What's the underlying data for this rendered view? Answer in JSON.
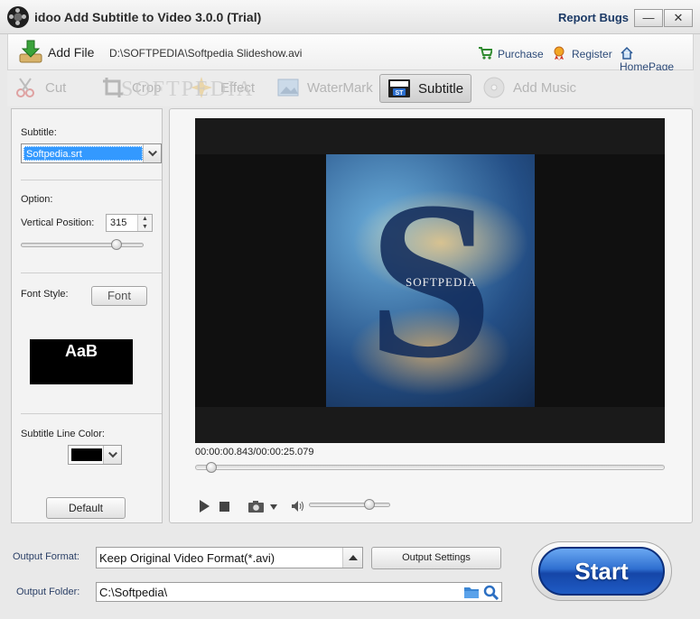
{
  "window": {
    "title": "idoo Add Subtitle to Video 3.0.0 (Trial)",
    "report_bugs": "Report Bugs",
    "minimize": "—",
    "close": "✕"
  },
  "file_bar": {
    "add_file": "Add File",
    "path": "D:\\SOFTPEDIA\\Softpedia Slideshow.avi",
    "purchase": "Purchase",
    "register": "Register",
    "homepage": "HomePage"
  },
  "tabs": [
    {
      "label": "Cut",
      "icon": "scissors-icon"
    },
    {
      "label": "Crop",
      "icon": "crop-icon"
    },
    {
      "label": "Effect",
      "icon": "sparkle-icon"
    },
    {
      "label": "WaterMark",
      "icon": "watermark-icon"
    },
    {
      "label": "Subtitle",
      "icon": "subtitle-icon",
      "active": true
    },
    {
      "label": "Add Music",
      "icon": "music-disc-icon"
    }
  ],
  "watermark_overlay": "SOFTPEDIA",
  "left_panel": {
    "subtitle_label": "Subtitle:",
    "subtitle_value": "Softpedia.srt",
    "option_label": "Option:",
    "vertical_position_label": "Vertical Position:",
    "vertical_position_value": "315",
    "vertical_position_fraction": 0.78,
    "font_style_label": "Font Style:",
    "font_button": "Font",
    "font_preview": "AaB",
    "line_color_label": "Subtitle Line Color:",
    "line_color": "#000000",
    "default_button": "Default"
  },
  "player": {
    "video_caption": "SOFTPEDIA",
    "video_letter": "S",
    "current_time": "00:00:00.843",
    "separator": "/",
    "total_time": "00:00:25.079",
    "seek_fraction": 0.034,
    "volume_fraction": 0.74
  },
  "bottom": {
    "output_format_label": "Output Format:",
    "output_format_value": "Keep Original Video Format(*.avi)",
    "output_settings_button": "Output Settings",
    "output_folder_label": "Output Folder:",
    "output_folder_value": "C:\\Softpedia\\",
    "start_button": "Start"
  },
  "colors": {
    "accent_blue": "#2f6fd0",
    "selection": "#3399ff",
    "link": "#2c4a78"
  }
}
